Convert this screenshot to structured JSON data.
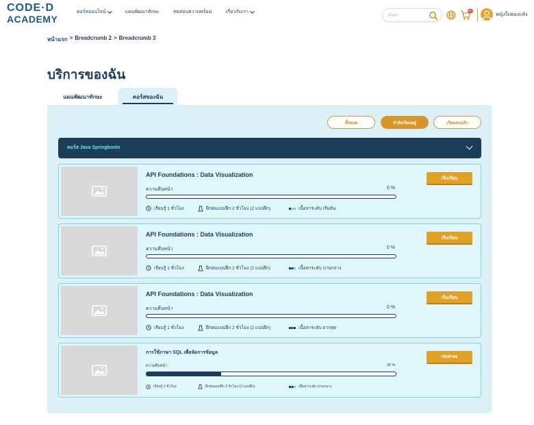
{
  "header": {
    "logo_line1": "CODE·D",
    "logo_line2": "ACADEMY",
    "nav": [
      {
        "label": "คอร์สออนไลน์",
        "has_dropdown": true
      },
      {
        "label": "แผนพัฒนาทักษะ",
        "has_dropdown": false
      },
      {
        "label": "ทดสอบความพร้อม",
        "has_dropdown": false
      },
      {
        "label": "เกี่ยวกับเรา",
        "has_dropdown": true
      }
    ],
    "search_placeholder": "ค้นหา",
    "cart_badge": "99+",
    "user_name": "หญิงใบตองแห้ง"
  },
  "breadcrumb": [
    "หน้าแรก",
    "Breadcrumb 2",
    "Breadcrumb 3"
  ],
  "breadcrumb_sep": ">",
  "page_title": "บริการของฉัน",
  "tabs": [
    {
      "label": "แผนพัฒนาทักษะ",
      "active": false
    },
    {
      "label": "คอร์สของฉัน",
      "active": true
    }
  ],
  "filters": [
    {
      "label": "ทั้งหมด",
      "active": false
    },
    {
      "label": "กำลังเรียนอยู่",
      "active": true
    },
    {
      "label": "เรียนจบแล้ว",
      "active": false
    }
  ],
  "course_group": {
    "label": "คอร์ส Java Springboots"
  },
  "cards": [
    {
      "title": "API Foundations : Data Visualization",
      "progress_label": "ความคืบหน้า",
      "progress_value": "0 %",
      "progress": 0,
      "duration": "เรียนรู้ 1 ชั่วโมง",
      "exercises": "ฝึกฝนแบบฝึก 2 ชั่วโมง (2 แบบฝึก)",
      "level": "เนื้อหาระดับ เริ่มต้น",
      "button": "เริ่มเรียน"
    },
    {
      "title": "API Foundations : Data Visualization",
      "progress_label": "ความคืบหน้า",
      "progress_value": "0 %",
      "progress": 0,
      "duration": "เรียนรู้ 1 ชั่วโมง",
      "exercises": "ฝึกฝนแบบฝึก 2 ชั่วโมง (2 แบบฝึก)",
      "level": "เนื้อหาระดับ ปานกลาง",
      "button": "เริ่มเรียน"
    },
    {
      "title": "API Foundations : Data Visualization",
      "progress_label": "ความคืบหน้า",
      "progress_value": "0 %",
      "progress": 0,
      "duration": "เรียนรู้ 1 ชั่วโมง",
      "exercises": "ฝึกฝนแบบฝึก 2 ชั่วโมง (2 แบบฝึก)",
      "level": "เนื้อหาระดับ ยากสุด",
      "button": "เริ่มเรียน"
    },
    {
      "title": "การใช้ภาษา SQL เพื่อจัดการข้อมูล",
      "progress_label": "ความคืบหน้า",
      "progress_value": "30 %",
      "progress": 30,
      "duration": "เรียนรู้ 1 ชั่วโมง",
      "exercises": "ฝึกฝนแบบฝึก 2 ชั่วโมง (2 แบบฝึก)",
      "level": "เนื้อหาระดับ ปานกลาง",
      "button": "กลับทำต่อ"
    }
  ],
  "colors": {
    "brand_navy": "#1b3d57",
    "accent_gold": "#e0a125",
    "panel_bg": "#dbf1f7",
    "card_bg": "#dff7fb",
    "group_label": "#6fe5e0"
  },
  "icons": [
    "search-icon",
    "globe-icon",
    "cart-icon",
    "avatar-icon",
    "chevron-down-icon",
    "image-placeholder-icon",
    "clock-icon",
    "exercise-icon",
    "level-icon"
  ]
}
